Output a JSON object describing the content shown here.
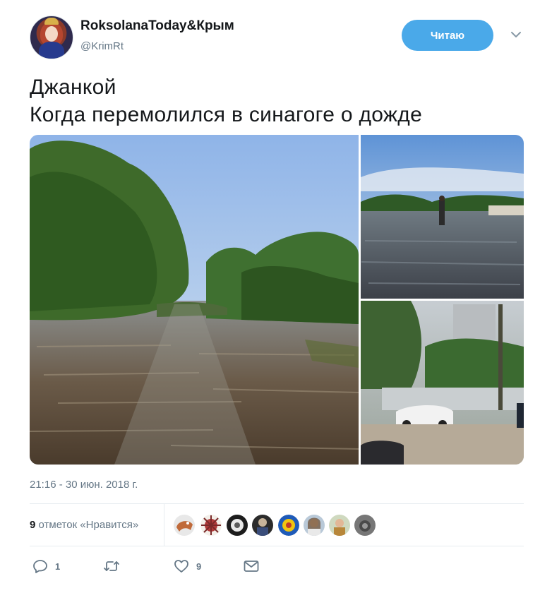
{
  "author": {
    "name": "RoksolanaToday&Крым",
    "handle": "@KrimRt",
    "follow_label": "Читаю"
  },
  "tweet": {
    "line1": "Джанкой",
    "line2": "Когда перемолился в синагоге о дожде",
    "timestamp": "21:16 - 30 июн. 2018 г."
  },
  "stats": {
    "likes_count": "9",
    "likes_label": "отметок «Нравится»"
  },
  "actions": {
    "reply_count": "1",
    "retweet_count": "",
    "like_count": "9"
  },
  "icons": {
    "reply": "reply-icon",
    "retweet": "retweet-icon",
    "like": "heart-icon",
    "message": "envelope-icon",
    "more": "chevron-down-icon"
  },
  "colors": {
    "accent": "#4aa9e9",
    "secondary_text": "#657786",
    "primary_text": "#14171a"
  }
}
